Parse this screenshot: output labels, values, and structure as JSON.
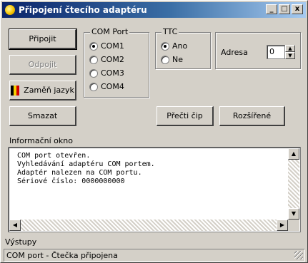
{
  "window": {
    "title": "Připojení čtecího adaptéru",
    "controls": {
      "minimize": "_",
      "maximize": "□",
      "close": "x"
    }
  },
  "buttons": {
    "connect": "Připojit",
    "disconnect": "Odpojit",
    "language": "Zaměň jazyk",
    "clear": "Smazat",
    "reconnect": "Přečti čip",
    "advanced": "Rozšířené"
  },
  "com_port": {
    "legend": "COM Port",
    "options": [
      "COM1",
      "COM2",
      "COM3",
      "COM4"
    ],
    "selected_index": 0
  },
  "mode": {
    "legend": "TTC",
    "options": [
      "Ano",
      "Ne"
    ],
    "selected_index": 0
  },
  "address": {
    "label": "Adresa",
    "value": "0"
  },
  "info_window": {
    "label": "Informační okno",
    "lines": [
      "COM port otevřen.",
      "Vyhledávání adaptéru COM portem.",
      "Adaptér nalezen na COM portu.",
      "Sériové číslo: 0000000000"
    ]
  },
  "output": {
    "label": "Výstupy",
    "status_text": "COM port - Čtečka připojena"
  },
  "colors": {
    "title_start": "#0a246a",
    "title_end": "#a6caf0",
    "face": "#d4d0c8"
  },
  "icons": {
    "title": "app-icon",
    "language": "flag-icon"
  }
}
